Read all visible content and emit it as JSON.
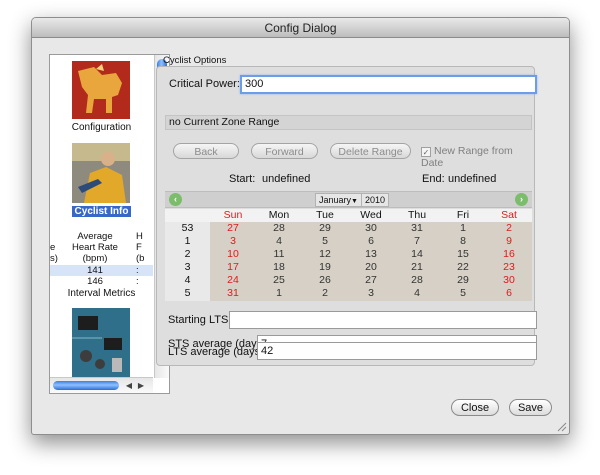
{
  "window": {
    "title": "Config Dialog"
  },
  "sidebar": {
    "items": [
      {
        "label": "Configuration",
        "icon": "configuration-horse-icon"
      },
      {
        "label": "Cyclist Info",
        "icon": "cyclist-photo-icon",
        "selected": true
      },
      {
        "label": "Interval Metrics",
        "icon": "interval-metrics-icon"
      },
      {
        "label": "",
        "icon": "circuit-board-icon"
      }
    ],
    "metrics_table": {
      "headers": [
        [
          "",
          "Average",
          "H"
        ],
        [
          "e",
          "Heart Rate",
          "F"
        ],
        [
          "s)",
          "(bpm)",
          "(b"
        ]
      ],
      "rows": [
        [
          "",
          "141",
          ":"
        ],
        [
          "",
          "146",
          ":"
        ]
      ]
    }
  },
  "cyclist": {
    "group_title": "Cyclist Options",
    "cp_label": "Critical Power:",
    "cp_value": "300",
    "zone_range": "no Current Zone Range",
    "buttons": {
      "back": "Back",
      "forward": "Forward",
      "delete": "Delete Range"
    },
    "new_range_label": "New Range from Date",
    "new_range_checked": true,
    "start_label": "Start:",
    "start_value": "undefined",
    "end_label": "End:",
    "end_value": "undefined"
  },
  "calendar": {
    "month": "January",
    "year": "2010",
    "days": [
      "Sun",
      "Mon",
      "Tue",
      "Wed",
      "Thu",
      "Fri",
      "Sat"
    ],
    "weeks": [
      {
        "week": "53",
        "dates": [
          "27",
          "28",
          "29",
          "30",
          "31",
          "1",
          "2"
        ]
      },
      {
        "week": "1",
        "dates": [
          "3",
          "4",
          "5",
          "6",
          "7",
          "8",
          "9"
        ]
      },
      {
        "week": "2",
        "dates": [
          "10",
          "11",
          "12",
          "13",
          "14",
          "15",
          "16"
        ]
      },
      {
        "week": "3",
        "dates": [
          "17",
          "18",
          "19",
          "20",
          "21",
          "22",
          "23"
        ]
      },
      {
        "week": "4",
        "dates": [
          "24",
          "25",
          "26",
          "27",
          "28",
          "29",
          "30"
        ]
      },
      {
        "week": "5",
        "dates": [
          "31",
          "1",
          "2",
          "3",
          "4",
          "5",
          "6"
        ]
      }
    ],
    "weekend_color": "#dd1c1c"
  },
  "lts": {
    "starting_label": "Starting LTS",
    "starting_value": "",
    "sts_label": "STS average (days)",
    "sts_value": "7",
    "lts_label": "LTS average (days)",
    "lts_value": "42"
  },
  "footer": {
    "close": "Close",
    "save": "Save"
  }
}
